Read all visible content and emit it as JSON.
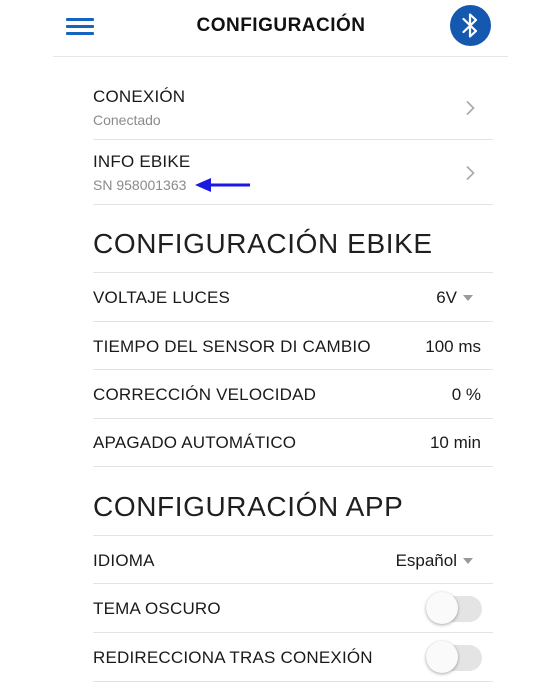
{
  "header": {
    "title": "CONFIGURACIÓN",
    "menu_icon": "hamburger-icon",
    "bluetooth_icon": "bluetooth-icon",
    "colors": {
      "accent": "#1565c0",
      "bluetooth_bg": "#1558b0"
    }
  },
  "connection": {
    "title": "CONEXIÓN",
    "status": "Conectado"
  },
  "ebike_info": {
    "title": "INFO EBIKE",
    "serial": "SN 958001363",
    "annotation_color": "#1a1ae0"
  },
  "ebike_config": {
    "section_title": "CONFIGURACIÓN EBIKE",
    "items": [
      {
        "label": "VOLTAJE LUCES",
        "value": "6V"
      },
      {
        "label": "TIEMPO DEL SENSOR DI CAMBIO",
        "value": "100 ms"
      },
      {
        "label": "CORRECCIÓN VELOCIDAD",
        "value": "0 %"
      },
      {
        "label": "APAGADO AUTOMÁTICO",
        "value": "10 min"
      }
    ]
  },
  "app_config": {
    "section_title": "CONFIGURACIÓN APP",
    "language": {
      "label": "IDIOMA",
      "value": "Español"
    },
    "dark_theme": {
      "label": "TEMA OSCURO",
      "enabled": false
    },
    "redirect": {
      "label": "REDIRECCIONA TRAS CONEXIÓN",
      "enabled": false
    }
  }
}
